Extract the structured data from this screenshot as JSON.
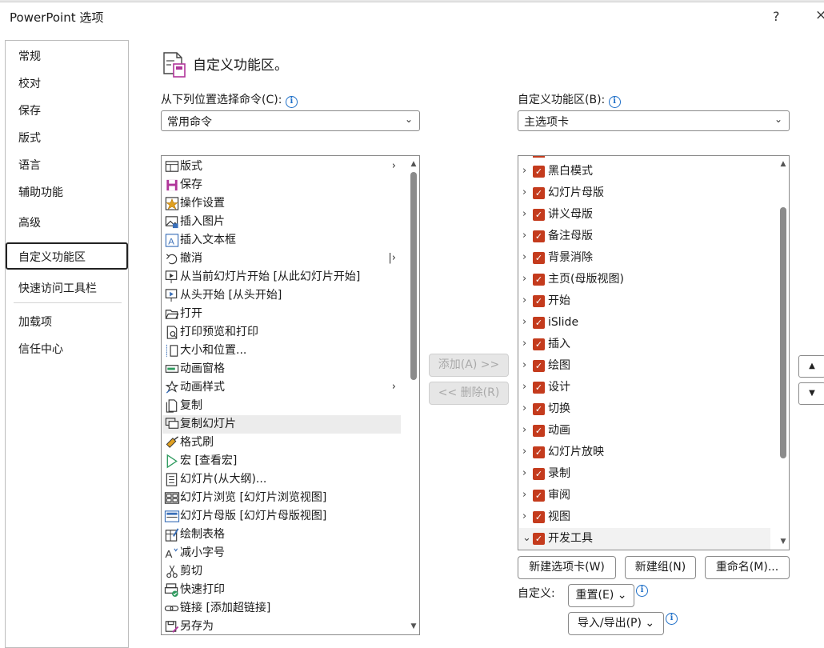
{
  "window": {
    "title": "PowerPoint 选项",
    "help": "?",
    "close": "×"
  },
  "nav": {
    "items": [
      "常规",
      "校对",
      "保存",
      "版式",
      "语言",
      "辅助功能",
      "高级",
      "自定义功能区",
      "快速访问工具栏",
      "加载项",
      "信任中心"
    ],
    "selected": "自定义功能区"
  },
  "heading": "自定义功能区。",
  "left": {
    "label": "从下列位置选择命令(C):",
    "select_value": "常用命令",
    "commands": [
      {
        "label": "版式",
        "icon": "layout-icon",
        "arrow": "›"
      },
      {
        "label": "保存",
        "icon": "save-icon"
      },
      {
        "label": "操作设置",
        "icon": "action-settings-icon"
      },
      {
        "label": "插入图片",
        "icon": "insert-picture-icon"
      },
      {
        "label": "插入文本框",
        "icon": "textbox-icon"
      },
      {
        "label": "撤消",
        "icon": "undo-icon",
        "arrow": "|›"
      },
      {
        "label": "从当前幻灯片开始 [从此幻灯片开始]",
        "icon": "play-from-current-icon"
      },
      {
        "label": "从头开始 [从头开始]",
        "icon": "play-from-start-icon"
      },
      {
        "label": "打开",
        "icon": "open-folder-icon"
      },
      {
        "label": "打印预览和打印",
        "icon": "print-preview-icon"
      },
      {
        "label": "大小和位置...",
        "icon": "size-position-icon"
      },
      {
        "label": "动画窗格",
        "icon": "animation-pane-icon"
      },
      {
        "label": "动画样式",
        "icon": "animation-styles-icon",
        "arrow": "›"
      },
      {
        "label": "复制",
        "icon": "copy-icon"
      },
      {
        "label": "复制幻灯片",
        "icon": "duplicate-slide-icon"
      },
      {
        "label": "格式刷",
        "icon": "format-painter-icon"
      },
      {
        "label": "宏 [查看宏]",
        "icon": "macro-icon"
      },
      {
        "label": "幻灯片(从大纲)...",
        "icon": "slides-from-outline-icon"
      },
      {
        "label": "幻灯片浏览 [幻灯片浏览视图]",
        "icon": "slide-sorter-icon"
      },
      {
        "label": "幻灯片母版 [幻灯片母版视图]",
        "icon": "slide-master-icon"
      },
      {
        "label": "绘制表格",
        "icon": "draw-table-icon"
      },
      {
        "label": "减小字号",
        "icon": "decrease-font-icon"
      },
      {
        "label": "剪切",
        "icon": "cut-icon"
      },
      {
        "label": "快速打印",
        "icon": "quick-print-icon"
      },
      {
        "label": "链接 [添加超链接]",
        "icon": "link-icon"
      },
      {
        "label": "另存为",
        "icon": "save-as-icon"
      }
    ],
    "selected_index": 14
  },
  "middle": {
    "add": "添加(A) >>",
    "remove": "<< 删除(R)"
  },
  "right": {
    "label": "自定义功能区(B):",
    "select_value": "主选项卡",
    "tabs": [
      "黑白模式",
      "幻灯片母版",
      "讲义母版",
      "备注母版",
      "背景消除",
      "主页(母版视图)",
      "开始",
      "iSlide",
      "插入",
      "绘图",
      "设计",
      "切换",
      "动画",
      "幻灯片放映",
      "录制",
      "审阅",
      "视图",
      "开发工具"
    ],
    "expanded_last": true,
    "new_tab": "新建选项卡(W)",
    "new_group": "新建组(N)",
    "rename": "重命名(M)...",
    "customize_label": "自定义:",
    "reset": "重置(E)",
    "import_export": "导入/导出(P)",
    "dropdown_chevron": "⌄"
  },
  "move_up": "▲",
  "move_down": "▼",
  "colors": {
    "checkbox": "#c43b1d",
    "accent_info": "#1e6fc8",
    "selection_row": "#ececec"
  }
}
